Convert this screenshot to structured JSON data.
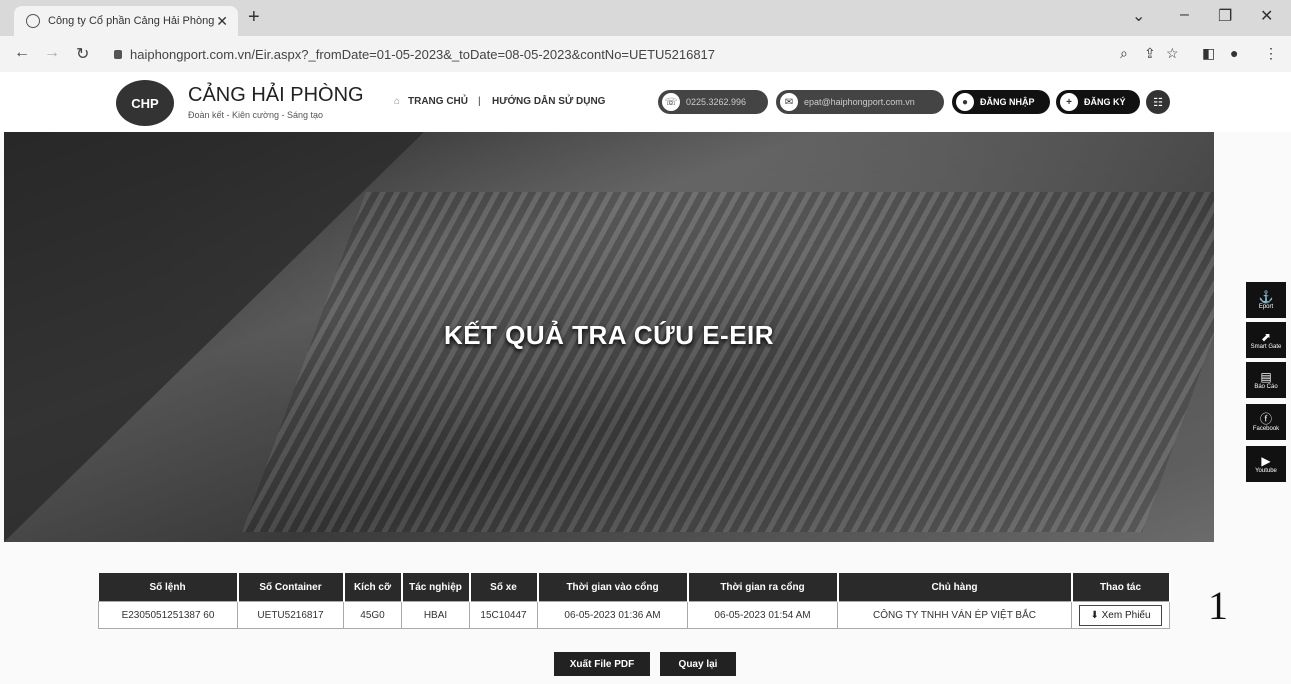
{
  "browser": {
    "tab_title": "Công ty Cổ phần Cảng Hải Phòng",
    "url": "haiphongport.com.vn/Eir.aspx?_fromDate=01-05-2023&_toDate=08-05-2023&contNo=UETU5216817"
  },
  "header": {
    "brand": "CẢNG HẢI PHÒNG",
    "slogan": "Đoàn kết - Kiên cường - Sáng tạo",
    "logo_text": "CHP",
    "nav_home": "TRANG CHỦ",
    "nav_separator": "|",
    "nav_guide": "HƯỚNG DẪN SỬ DỤNG",
    "phone": "0225.3262.996",
    "email": "epat@haiphongport.com.vn",
    "login": "ĐĂNG NHẬP",
    "register": "ĐĂNG KÝ"
  },
  "hero": {
    "title": "KẾT QUẢ TRA CỨU E-EIR"
  },
  "social": [
    {
      "icon": "eport-icon",
      "label": "Eport"
    },
    {
      "icon": "smart-gate-icon",
      "label": "Smart Gate"
    },
    {
      "icon": "report-icon",
      "label": "Báo Cáo"
    },
    {
      "icon": "facebook-icon",
      "label": "Facebook"
    },
    {
      "icon": "youtube-icon",
      "label": "Youtube"
    }
  ],
  "table": {
    "headers": [
      "Số lệnh",
      "Số Container",
      "Kích cỡ",
      "Tác nghiệp",
      "Số xe",
      "Thời gian vào cổng",
      "Thời gian ra cổng",
      "Chủ hàng",
      "Thao tác"
    ],
    "rows": [
      [
        "E2305051251387 60",
        "UETU5216817",
        "45G0",
        "HBAI",
        "15C10447",
        "06-05-2023 01:36 AM",
        "06-05-2023 01:54 AM",
        "CÔNG TY TNHH VÁN ÉP VIỆT BẮC"
      ]
    ],
    "action_label": "Xem Phiếu"
  },
  "annotation": "1",
  "buttons": {
    "export_pdf": "Xuất File PDF",
    "back": "Quay lại"
  }
}
